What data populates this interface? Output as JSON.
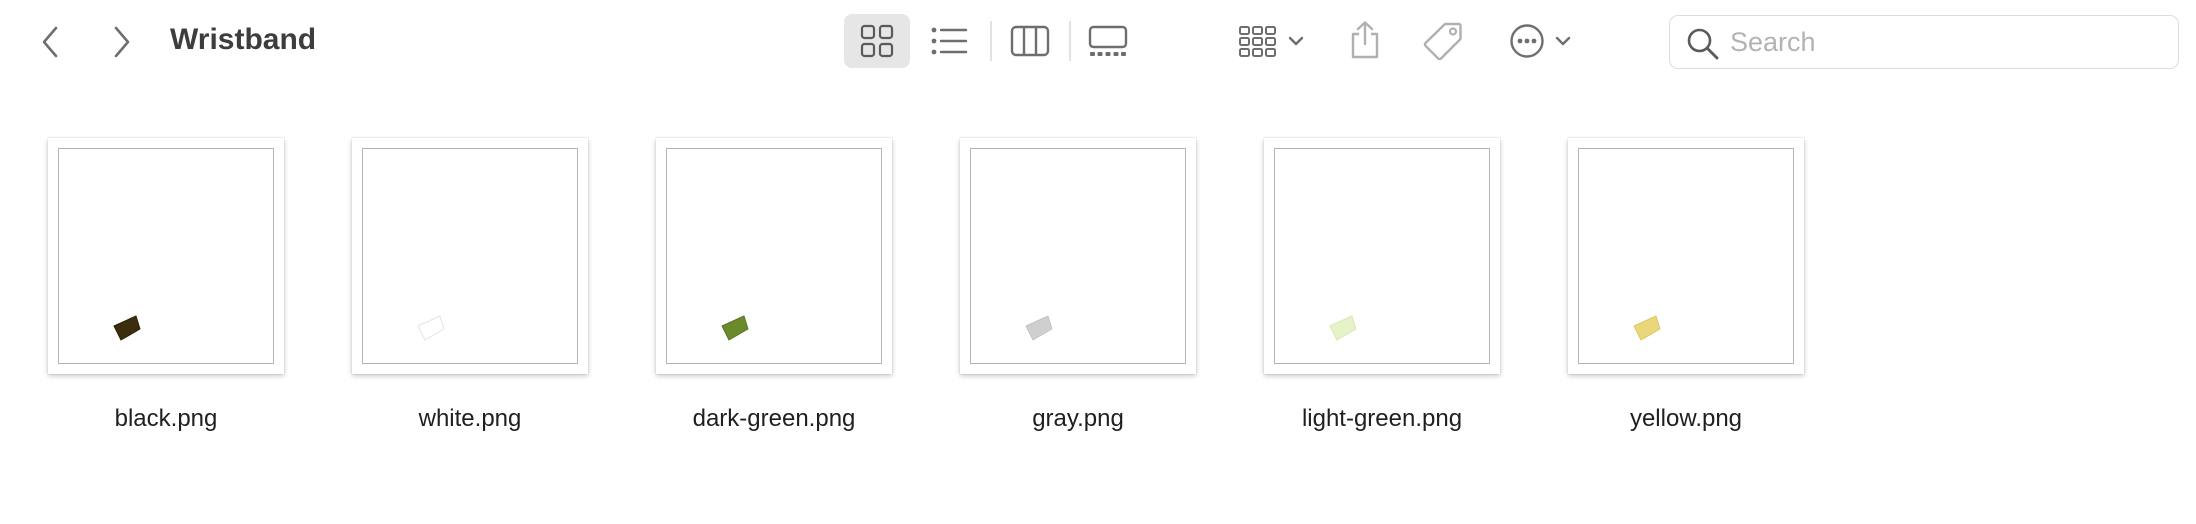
{
  "window": {
    "title": "Wristband"
  },
  "toolbar": {
    "back_icon": "chevron-left-icon",
    "forward_icon": "chevron-right-icon",
    "view_icon_grid": "icon-view-grid-icon",
    "view_list": "list-view-icon",
    "view_columns": "column-view-icon",
    "view_gallery": "gallery-view-icon",
    "group_by": "group-by-icon",
    "share": "share-icon",
    "tags": "tag-icon",
    "more": "more-actions-icon",
    "selected_view": "icons"
  },
  "search": {
    "placeholder": "Search",
    "value": ""
  },
  "files": [
    {
      "name": "black.png",
      "color": "#3a2e0c",
      "stroke": "#2a2108"
    },
    {
      "name": "white.png",
      "color": "#ffffff",
      "stroke": "#e4e4e4"
    },
    {
      "name": "dark-green.png",
      "color": "#6b8a2c",
      "stroke": "#5a7524"
    },
    {
      "name": "gray.png",
      "color": "#cfcfcf",
      "stroke": "#c4c4c4"
    },
    {
      "name": "light-green.png",
      "color": "#e6f2c8",
      "stroke": "#d9e8b4"
    },
    {
      "name": "yellow.png",
      "color": "#e9d77a",
      "stroke": "#dcc864"
    }
  ],
  "colors": {
    "accent_selected_bg": "#e6e6e6",
    "icon_gray": "#6e6e6e"
  }
}
